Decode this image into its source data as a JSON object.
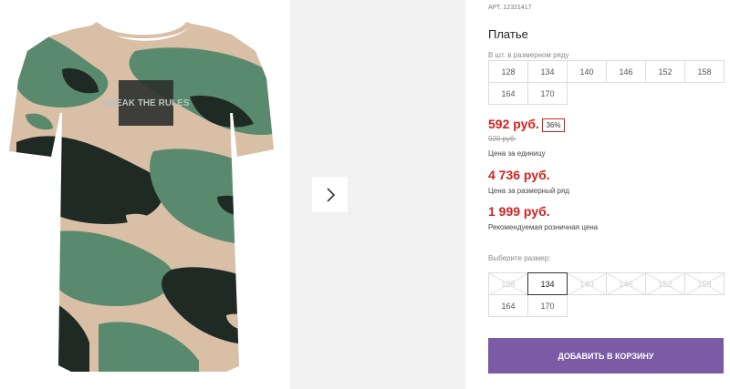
{
  "product": {
    "article": "АРТ. 12321417",
    "title": "Платье",
    "dress_print_text": "BREAK THE RULES"
  },
  "sizes_row": {
    "hint": "В шт. в размерном ряду",
    "sizes": [
      "128",
      "134",
      "140",
      "146",
      "152",
      "158",
      "164",
      "170"
    ]
  },
  "pricing": {
    "unit_price": "592 руб.",
    "discount_badge": "36%",
    "old_price": "920 руб.",
    "unit_label": "Цена за единицу",
    "row_price": "4 736 руб.",
    "row_label": "Цена за размерный ряд",
    "retail_price": "1 999 руб.",
    "retail_label": "Рекомендуемая розничная цена",
    "accent_color": "#d0231f"
  },
  "size_select": {
    "hint": "Выберите размер:",
    "options": [
      {
        "label": "128",
        "available": false,
        "selected": false
      },
      {
        "label": "134",
        "available": true,
        "selected": true
      },
      {
        "label": "140",
        "available": false,
        "selected": false
      },
      {
        "label": "146",
        "available": false,
        "selected": false
      },
      {
        "label": "152",
        "available": false,
        "selected": false
      },
      {
        "label": "158",
        "available": false,
        "selected": false
      },
      {
        "label": "164",
        "available": true,
        "selected": false
      },
      {
        "label": "170",
        "available": true,
        "selected": false
      }
    ]
  },
  "gallery": {
    "next_icon": "chevron-right-icon"
  },
  "cart": {
    "button_label": "ДОБАВИТЬ В КОРЗИНУ",
    "button_color": "#7b5ba6"
  }
}
